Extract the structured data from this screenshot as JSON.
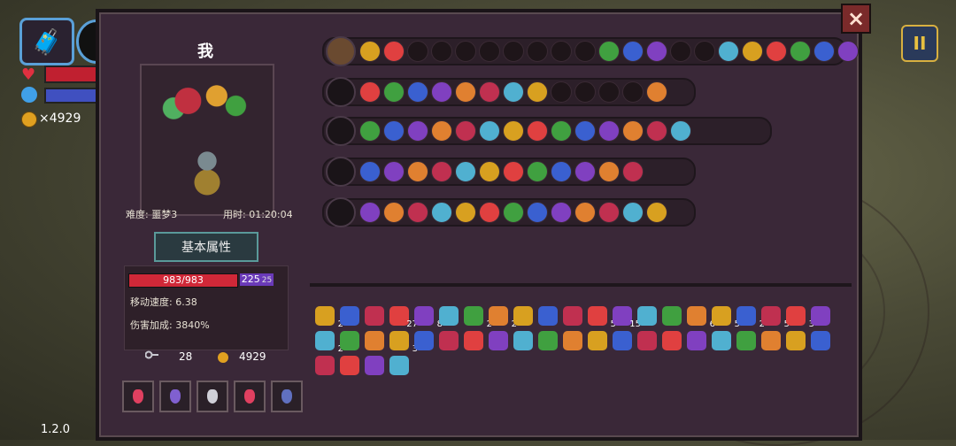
{
  "hud": {
    "coins": "×4929",
    "version": "1.2.0",
    "pause_label": "II"
  },
  "panel": {
    "close_label": "×",
    "character_name": "我",
    "difficulty": "难度: 噩梦3",
    "time": "用时: 01:20:04",
    "attr_title": "基本属性",
    "hp": "983/983",
    "shield": "225",
    "shield_extra": "25",
    "move_speed": "移动速度: 6.38",
    "damage_bonus": "伤害加成: 3840%",
    "keys": "28",
    "gold": "4929"
  },
  "colors": {
    "panel": "#3a2838",
    "accent_red": "#d02838",
    "accent_purple": "#6a3ab8",
    "coin": "#e0a020"
  },
  "potions": [
    "red-potion",
    "blue-potion",
    "white-potion",
    "red-potion",
    "blue-potion"
  ],
  "item_counts": [
    "2",
    "27",
    "8",
    "2",
    "2",
    "5",
    "15",
    "6",
    "5",
    "2",
    "5",
    "3",
    "2",
    "3"
  ]
}
